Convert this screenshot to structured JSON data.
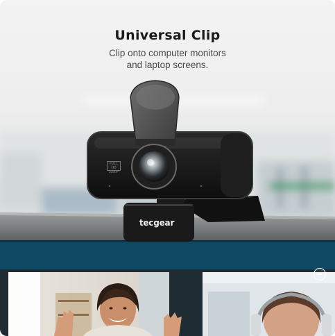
{
  "hero": {
    "title": "Universal Clip",
    "subtitle_lines": [
      "Clip onto computer monitors",
      "and laptop screens."
    ]
  },
  "product": {
    "brand": "tecgear",
    "badge_lines": [
      "FULL HD",
      "1080P"
    ]
  },
  "colors": {
    "title": "#1b1b1b",
    "subtitle": "#4a4a4a",
    "screen_blue": "#0e4a63",
    "webcam_body": "#161616",
    "window_green": "#3f9a68"
  }
}
